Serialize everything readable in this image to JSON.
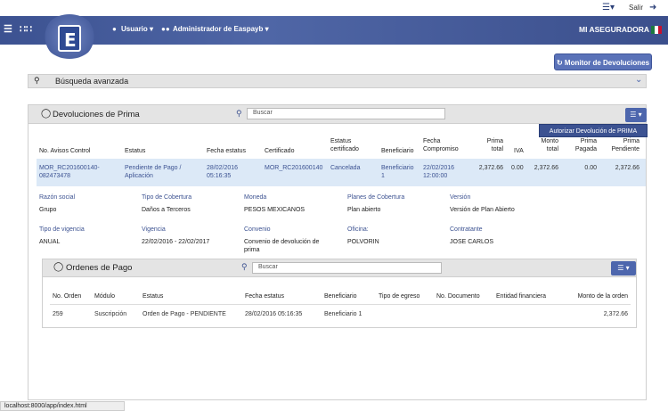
{
  "topbar": {
    "salir_label": "Salir"
  },
  "navbar": {
    "usuario_label": "Usuario",
    "admin_label": "Administrador de Easpayb",
    "company": "MI ASEGURADORA"
  },
  "monitor_button": "Monitor de Devoluciones",
  "busqueda_label": "Búsqueda avanzada",
  "devoluciones": {
    "title": "Devoluciones de Prima",
    "search_placeholder": "Buscar",
    "dropdown_item": "Autorizar Devolución de PRIMA",
    "columns": [
      "No. Avisos Control",
      "Estatus",
      "Fecha estatus",
      "Certificado",
      "Estatus certificado",
      "Beneficiario",
      "Fecha Compromiso",
      "Prima total",
      "IVA",
      "Monto total",
      "Prima Pagada",
      "Prima Pendiente"
    ],
    "row": {
      "aviso": "MOR_RC201600140-082473478",
      "estatus": "Pendiente de Pago / Aplicación",
      "fecha_estatus": "28/02/2016 05:16:35",
      "certificado": "MOR_RC201600140",
      "estatus_cert": "Cancelada",
      "beneficiario": "Beneficiario 1",
      "fecha_compromiso": "22/02/2016 12:00:00",
      "prima_total": "2,372.66",
      "iva": "0.00",
      "monto_total": "2,372.66",
      "prima_pagada": "0.00",
      "prima_pendiente": "2,372.66"
    },
    "details": {
      "razon_social_label": "Razón social",
      "razon_social": "Grupo",
      "tipo_cobertura_label": "Tipo de Cobertura",
      "tipo_cobertura": "Daños a Terceros",
      "moneda_label": "Moneda",
      "moneda": "PESOS MEXICANOS",
      "planes_label": "Planes de Cobertura",
      "planes": "Plan abierto",
      "version_label": "Versión",
      "version": "Versión de Plan Abierto",
      "tipo_vigencia_label": "Tipo de vigencia",
      "tipo_vigencia": "ANUAL",
      "vigencia_label": "Vigencia",
      "vigencia": "22/02/2016 - 22/02/2017",
      "convenio_label": "Convenio",
      "convenio": "Convenio de devolución de prima",
      "oficina_label": "Oficina:",
      "oficina": "POLVORIN",
      "contratante_label": "Contratante",
      "contratante": "JOSE CARLOS"
    }
  },
  "ordenes": {
    "title": "Ordenes de Pago",
    "search_placeholder": "Buscar",
    "columns": [
      "No. Orden",
      "Módulo",
      "Estatus",
      "Fecha estatus",
      "Beneficiario",
      "Tipo de egreso",
      "No. Documento",
      "Entidad financiera",
      "Monto de la orden"
    ],
    "row": {
      "no_orden": "259",
      "modulo": "Suscripción",
      "estatus": "Orden de Pago - PENDIENTE",
      "fecha": "28/02/2016 05:16:35",
      "beneficiario": "Beneficiario 1",
      "monto": "2,372.66"
    }
  },
  "status_url": "localhost:8000/app/index.html",
  "colors": {
    "navbar": "#3c5291",
    "accent": "#5a72b8",
    "row_highlight": "#dce9f7"
  }
}
